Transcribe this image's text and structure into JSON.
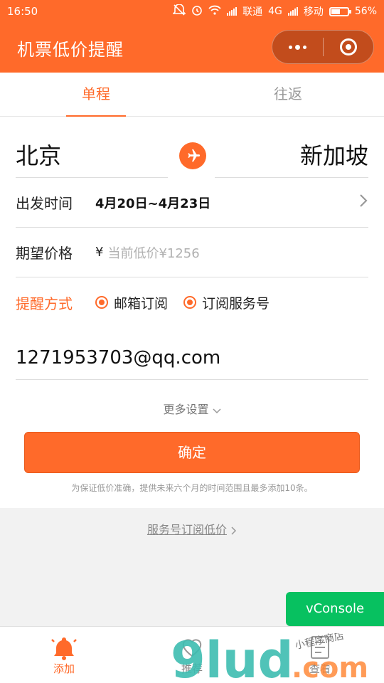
{
  "status_bar": {
    "time": "16:50",
    "carrier1": "联通",
    "network": "4G",
    "carrier2": "移动",
    "battery": "56%",
    "battery_level": 0.56
  },
  "navbar": {
    "title": "机票低价提醒"
  },
  "tabs": [
    {
      "label": "单程",
      "active": true
    },
    {
      "label": "往返",
      "active": false
    }
  ],
  "route": {
    "from": "北京",
    "to": "新加坡"
  },
  "departure": {
    "label": "出发时间",
    "value": "4月20日~4月23日"
  },
  "price": {
    "label": "期望价格",
    "currency": "¥",
    "placeholder": "当前低价¥1256"
  },
  "notify": {
    "label": "提醒方式",
    "options": [
      {
        "label": "邮箱订阅"
      },
      {
        "label": "订阅服务号"
      }
    ]
  },
  "email": "1271953703@qq.com",
  "more_settings": "更多设置",
  "confirm_label": "确定",
  "note": "为保证低价准确，提供未来六个月的时间范围且最多添加10条。",
  "service_link": "服务号订阅低价",
  "vconsole": "vConsole",
  "tabbar": [
    {
      "label": "添加",
      "icon": "bell-icon",
      "active": true
    },
    {
      "label": "推荐",
      "icon": "heart-icon",
      "active": false
    },
    {
      "label": "查看",
      "icon": "list-icon",
      "active": false
    }
  ],
  "watermark": {
    "brand": "9lud",
    "suffix": ".com",
    "shop": "小程序商店"
  },
  "colors": {
    "accent": "#ff6a2a",
    "vconsole": "#07c160",
    "watermark": "#3dbcb0"
  }
}
